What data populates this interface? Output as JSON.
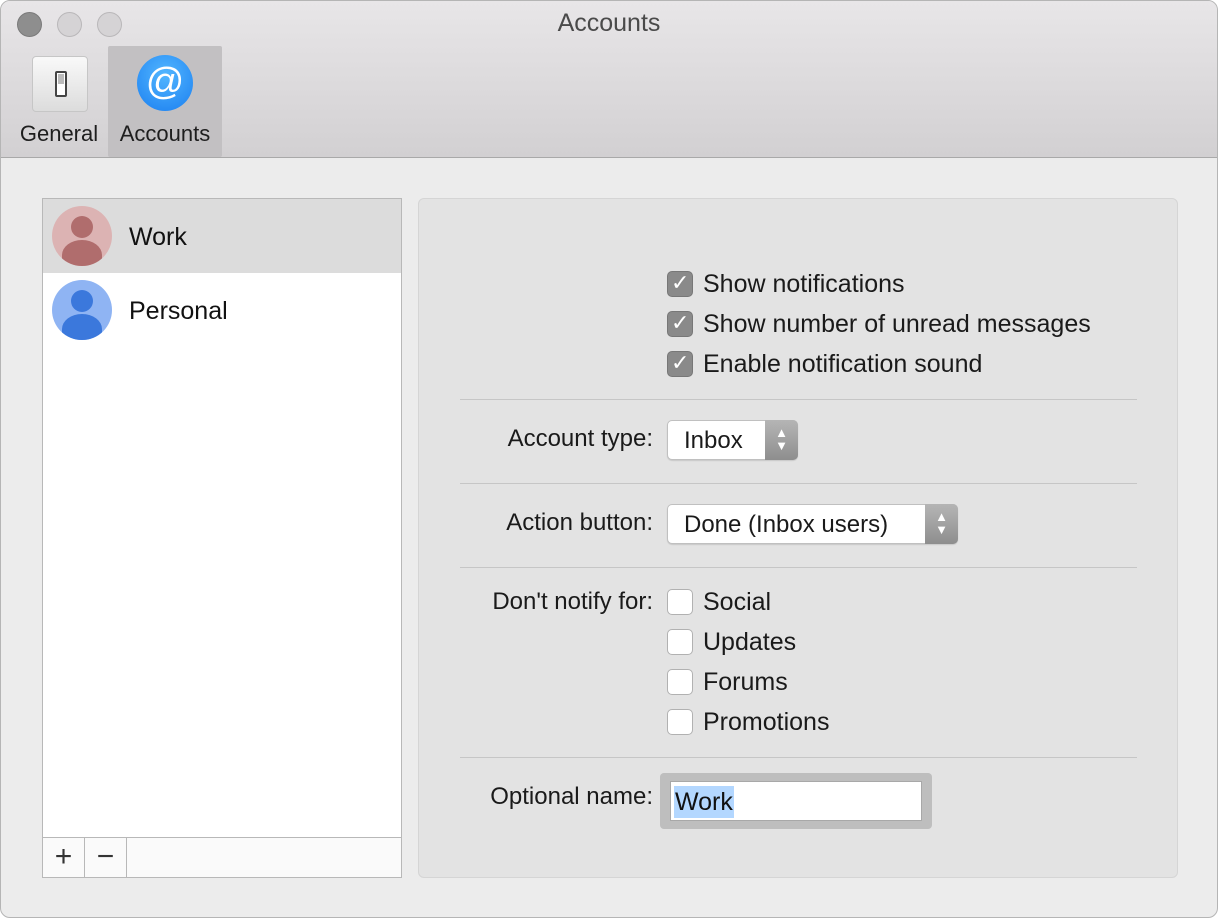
{
  "window": {
    "title": "Accounts"
  },
  "toolbar": {
    "items": [
      {
        "label": "General",
        "icon": "switch-icon"
      },
      {
        "label": "Accounts",
        "icon": "at-sign-icon",
        "glyph": "@"
      }
    ]
  },
  "accounts": {
    "items": [
      {
        "name": "Work",
        "selected": true
      },
      {
        "name": "Personal",
        "selected": false
      }
    ],
    "add_label": "+",
    "remove_label": "−"
  },
  "settings": {
    "notifications": [
      {
        "label": "Show notifications",
        "checked": true
      },
      {
        "label": "Show number of unread messages",
        "checked": true
      },
      {
        "label": "Enable notification sound",
        "checked": true
      }
    ],
    "account_type": {
      "label": "Account type:",
      "value": "Inbox"
    },
    "action_button": {
      "label": "Action button:",
      "value": "Done (Inbox users)"
    },
    "dont_notify": {
      "label": "Don't notify for:",
      "options": [
        {
          "label": "Social",
          "checked": false
        },
        {
          "label": "Updates",
          "checked": false
        },
        {
          "label": "Forums",
          "checked": false
        },
        {
          "label": "Promotions",
          "checked": false
        }
      ]
    },
    "optional_name": {
      "label": "Optional name:",
      "value": "Work"
    }
  },
  "colors": {
    "accent": "#1b7ff0",
    "work_avatar": "#b06d6d",
    "personal_avatar": "#3b78dc",
    "selection": "#b3d7ff"
  }
}
